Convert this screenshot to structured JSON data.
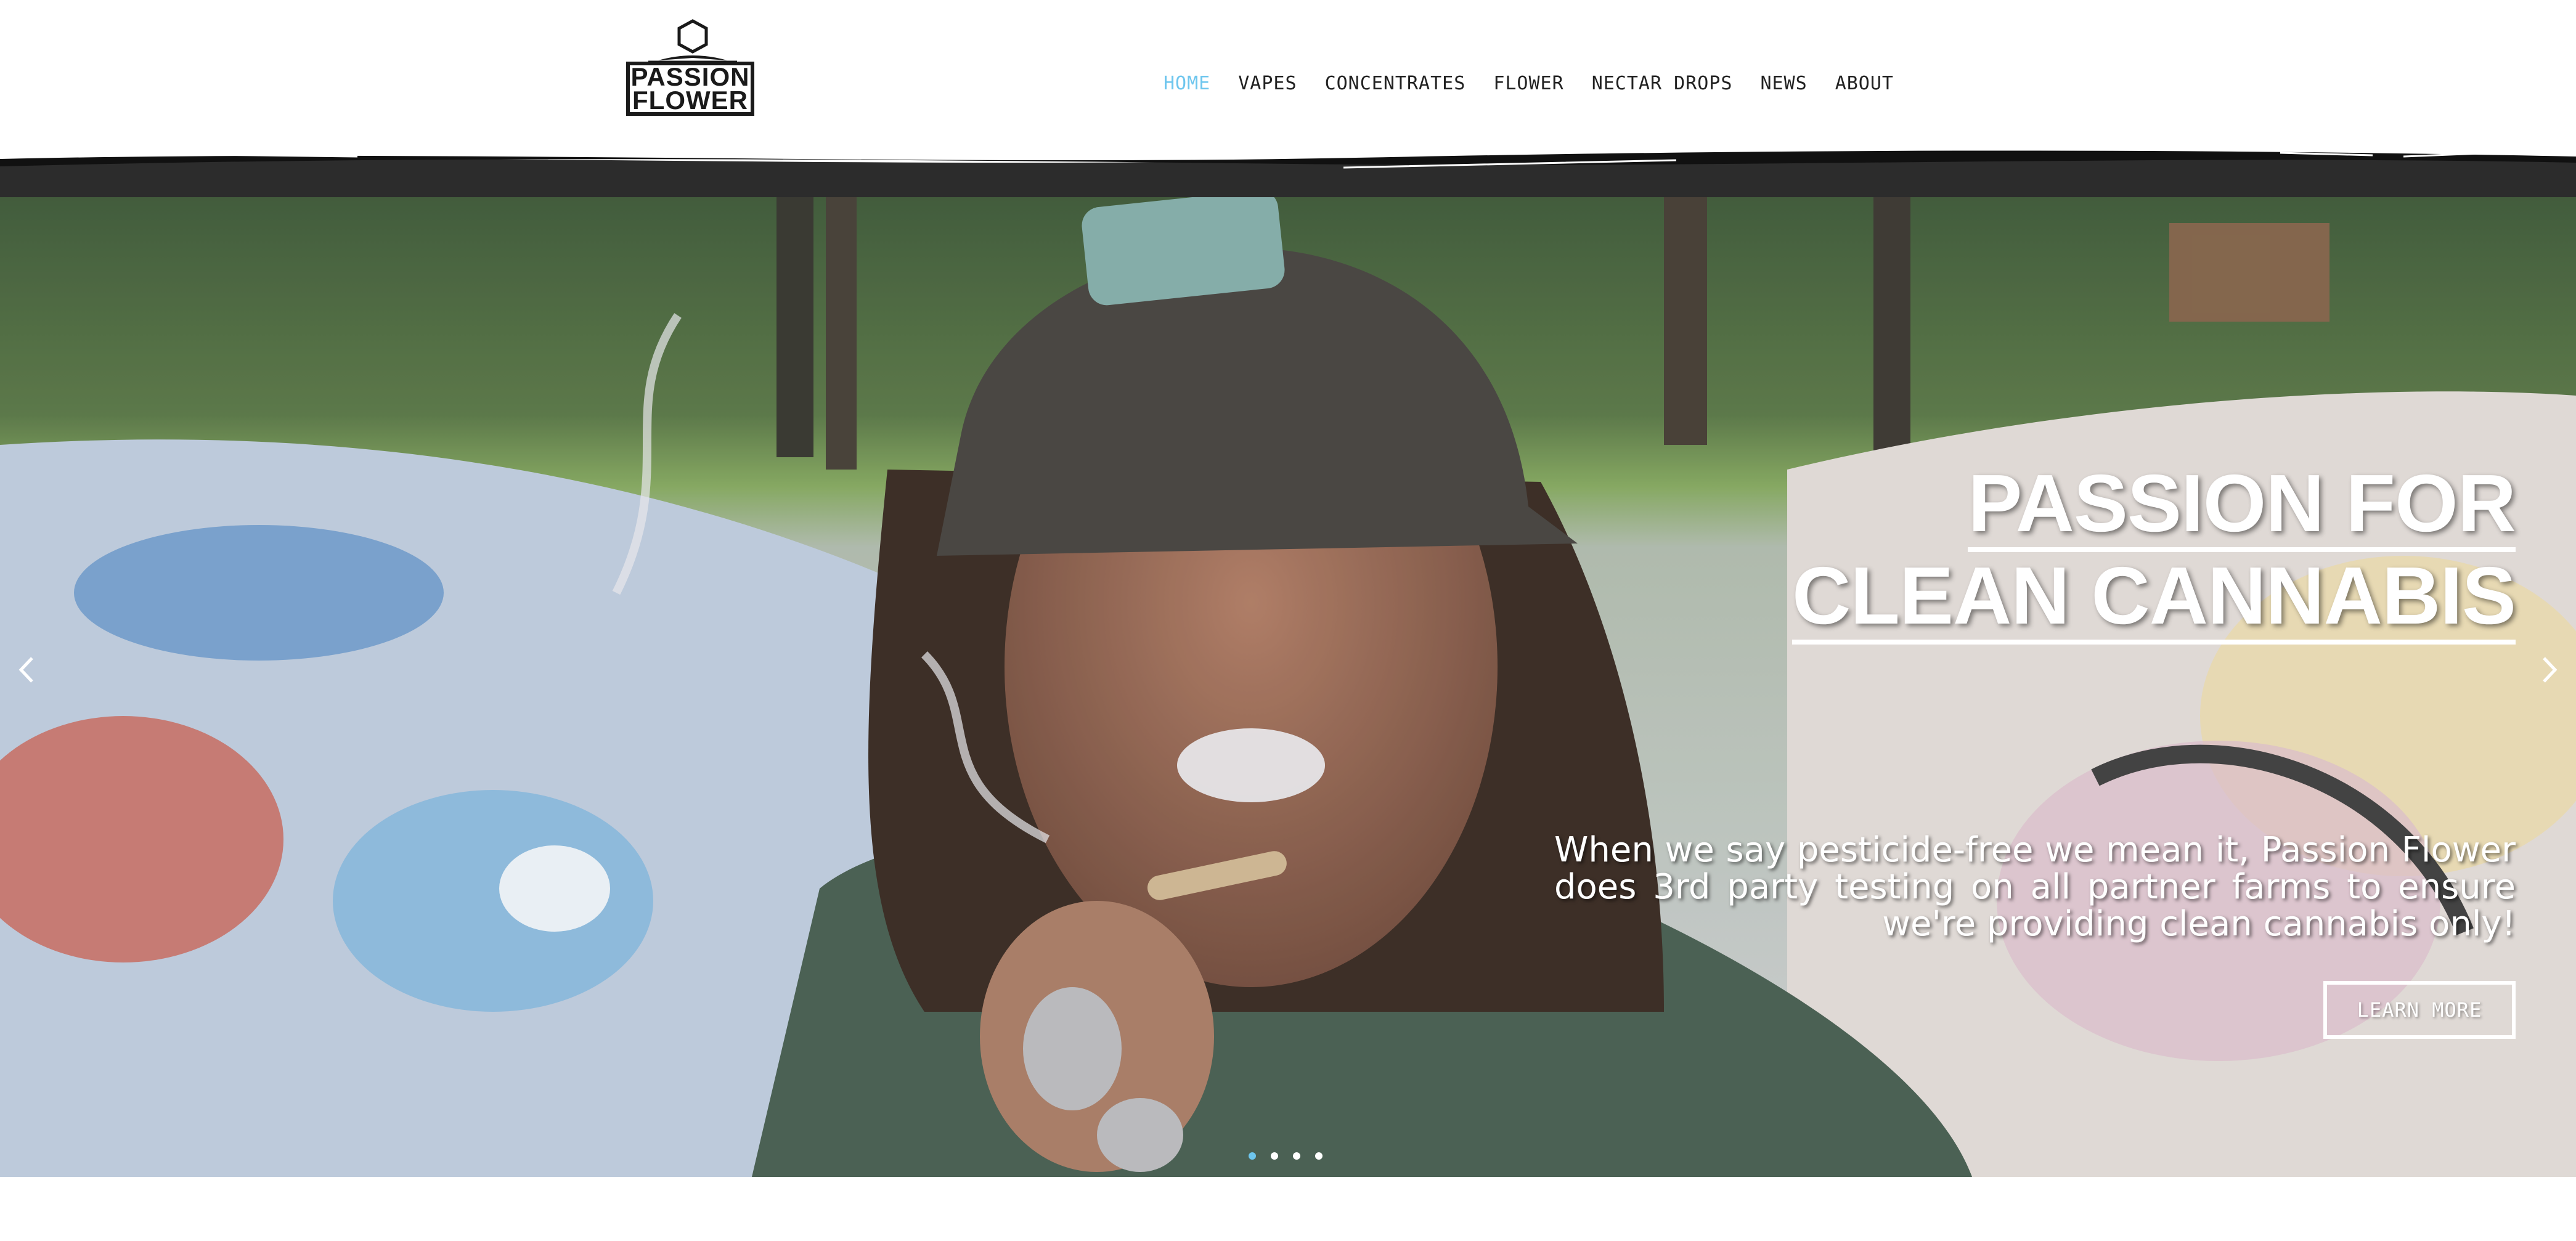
{
  "brand": {
    "logo_line1": "PASSION",
    "logo_line2": "FLOWER"
  },
  "nav": {
    "items": [
      {
        "label": "HOME",
        "active": true
      },
      {
        "label": "VAPES",
        "active": false
      },
      {
        "label": "CONCENTRATES",
        "active": false
      },
      {
        "label": "FLOWER",
        "active": false
      },
      {
        "label": "NECTAR DROPS",
        "active": false
      },
      {
        "label": "NEWS",
        "active": false
      },
      {
        "label": "ABOUT",
        "active": false
      }
    ]
  },
  "hero": {
    "title_line1": "PASSION FOR",
    "title_line2": "CLEAN CANNABIS",
    "subtitle": "When we say pesticide-free we mean it, Passion Flower does 3rd party testing on all partner farms to ensure we're providing clean cannabis only!",
    "cta_label": "LEARN MORE",
    "slide_count": 4,
    "active_slide": 1
  },
  "colors": {
    "accent": "#6ec6ee",
    "text_dark": "#222222",
    "hero_text": "#ffffff"
  },
  "icons": {
    "prev": "chevron-left-icon",
    "next": "chevron-right-icon",
    "logo": "hexagon-logo-icon"
  }
}
